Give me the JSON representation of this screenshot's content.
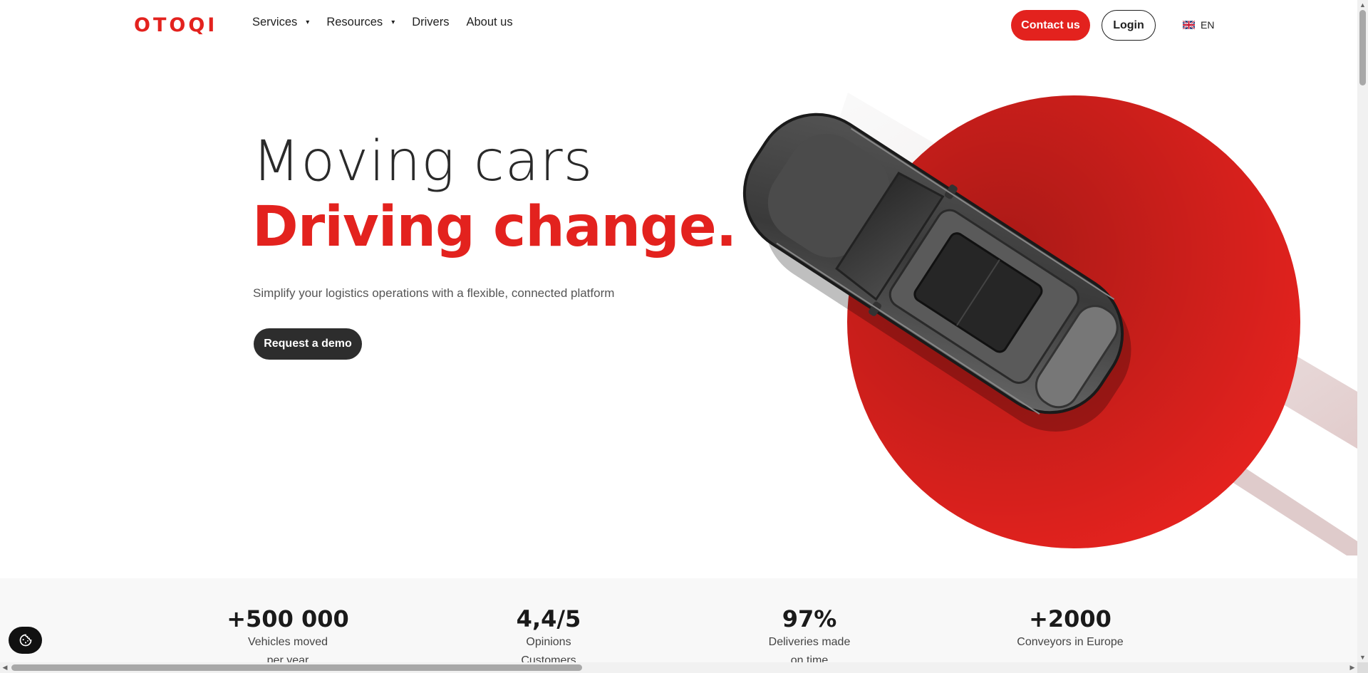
{
  "header": {
    "logo": "OTOQI",
    "nav": [
      {
        "label": "Services",
        "has_dropdown": true
      },
      {
        "label": "Resources",
        "has_dropdown": true
      },
      {
        "label": "Drivers",
        "has_dropdown": false
      },
      {
        "label": "About us",
        "has_dropdown": false
      }
    ],
    "contact_label": "Contact us",
    "login_label": "Login",
    "language": "EN",
    "language_icon": "uk-flag-icon"
  },
  "hero": {
    "line1": "Moving cars",
    "line2": "Driving change.",
    "subtitle": "Simplify your logistics operations with a flexible, connected platform",
    "cta_label": "Request a demo"
  },
  "stats": [
    {
      "value": "+500 000",
      "label_line1": "Vehicles moved",
      "label_line2": "per year"
    },
    {
      "value": "4,4/5",
      "label_line1": "Opinions",
      "label_line2": "Customers"
    },
    {
      "value": "97%",
      "label_line1": "Deliveries made",
      "label_line2": "on time"
    },
    {
      "value": "+2000",
      "label_line1": "Conveyors in Europe",
      "label_line2": ""
    }
  ],
  "colors": {
    "brand_red": "#e3221e",
    "dark": "#2d2d2d",
    "stats_bg": "#f8f8f8"
  },
  "icons": {
    "cookie": "cookie-settings-icon",
    "caret": "chevron-down-icon"
  }
}
